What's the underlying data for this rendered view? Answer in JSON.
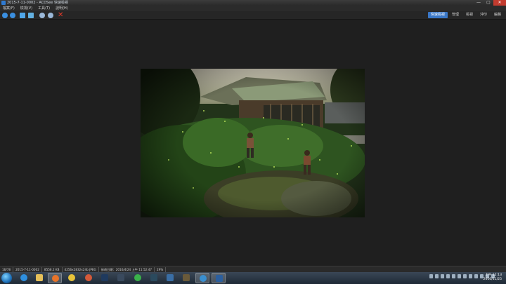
{
  "window": {
    "title": "2015-7-11-0002 - ACDSee 快速檢視",
    "controls": [
      "—",
      "▢",
      "✕"
    ]
  },
  "menu": [
    "檔案(F)",
    "檢視(V)",
    "工具(T)",
    "說明(H)"
  ],
  "toolbar": {
    "icons": [
      "back-icon",
      "forward-icon",
      "save-icon",
      "image-icon",
      "zoom-in-icon",
      "zoom-out-icon",
      "delete-icon"
    ]
  },
  "mode_tabs": [
    "快速檢視",
    "管理",
    "檢視",
    "沖印",
    "編輯"
  ],
  "status": [
    "16/78",
    "2015-7-11-0002",
    "8558.2 KB",
    "4256x2832x24b JPEG",
    "修改日期：2016/4/24 上午 11:52:47",
    "29%"
  ],
  "taskbar": {
    "apps": [
      "ie",
      "explorer",
      "firefox",
      "chrome",
      "chrome-alt",
      "photoshop",
      "lightroom",
      "line",
      "app-9",
      "app-10",
      "app-11",
      "acdsee",
      "acdsee-active"
    ]
  },
  "clock": {
    "time": "上午 12:13",
    "date": "2016/11/25"
  }
}
